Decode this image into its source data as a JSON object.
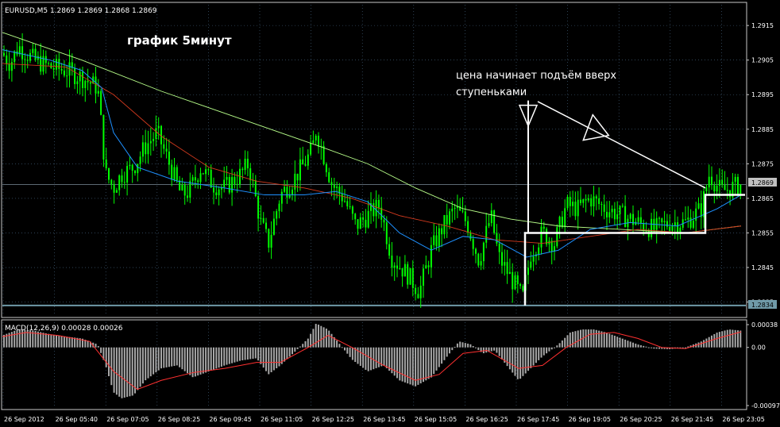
{
  "chart_data": [
    {
      "type": "candlestick",
      "title": "EURUSD,M5  1.2869 1.2869 1.2868 1.2869",
      "annotation_title": "график 5минут",
      "annotation_note": [
        "цена начинает подъём вверх",
        "ступеньками"
      ],
      "y_ticks": [
        "1.2915",
        "1.2905",
        "1.2895",
        "1.2885",
        "1.2875",
        "1.2865",
        "1.2855",
        "1.2845",
        "1.2835"
      ],
      "y_range": [
        1.2831,
        1.2921
      ],
      "current_price": "1.2869",
      "line_price": "1.2834",
      "x_ticks": [
        "26 Sep 2012",
        "26 Sep 05:40",
        "26 Sep 07:05",
        "26 Sep 08:25",
        "26 Sep 09:45",
        "26 Sep 11:05",
        "26 Sep 12:25",
        "26 Sep 13:45",
        "26 Sep 15:05",
        "26 Sep 16:25",
        "26 Sep 17:45",
        "26 Sep 19:05",
        "26 Sep 20:25",
        "26 Sep 21:45",
        "26 Sep 23:05"
      ],
      "price_path": [
        [
          0,
          1.2907
        ],
        [
          10,
          1.2904
        ],
        [
          20,
          1.2909
        ],
        [
          40,
          1.2905
        ],
        [
          60,
          1.2903
        ],
        [
          80,
          1.2902
        ],
        [
          100,
          1.29
        ],
        [
          120,
          1.2897
        ],
        [
          125,
          1.2885
        ],
        [
          130,
          1.2872
        ],
        [
          140,
          1.2868
        ],
        [
          150,
          1.2872
        ],
        [
          165,
          1.2874
        ],
        [
          180,
          1.288
        ],
        [
          195,
          1.2884
        ],
        [
          210,
          1.2875
        ],
        [
          225,
          1.2866
        ],
        [
          235,
          1.2867
        ],
        [
          250,
          1.2874
        ],
        [
          265,
          1.2869
        ],
        [
          280,
          1.2868
        ],
        [
          300,
          1.2872
        ],
        [
          310,
          1.2875
        ],
        [
          325,
          1.2858
        ],
        [
          335,
          1.2852
        ],
        [
          350,
          1.2866
        ],
        [
          365,
          1.287
        ],
        [
          380,
          1.2875
        ],
        [
          390,
          1.2879
        ],
        [
          395,
          1.2885
        ],
        [
          405,
          1.2877
        ],
        [
          415,
          1.2869
        ],
        [
          430,
          1.2865
        ],
        [
          445,
          1.2857
        ],
        [
          460,
          1.286
        ],
        [
          475,
          1.2863
        ],
        [
          490,
          1.2848
        ],
        [
          510,
          1.2843
        ],
        [
          525,
          1.2838
        ],
        [
          540,
          1.285
        ],
        [
          555,
          1.2857
        ],
        [
          570,
          1.2862
        ],
        [
          585,
          1.2858
        ],
        [
          600,
          1.2847
        ],
        [
          615,
          1.286
        ],
        [
          625,
          1.2848
        ],
        [
          640,
          1.2842
        ],
        [
          655,
          1.2836
        ],
        [
          665,
          1.2849
        ],
        [
          680,
          1.2855
        ],
        [
          695,
          1.2852
        ],
        [
          710,
          1.2863
        ],
        [
          725,
          1.2862
        ],
        [
          740,
          1.2865
        ],
        [
          760,
          1.2862
        ],
        [
          780,
          1.286
        ],
        [
          800,
          1.2858
        ],
        [
          820,
          1.2856
        ],
        [
          840,
          1.2858
        ],
        [
          860,
          1.2858
        ],
        [
          880,
          1.2862
        ],
        [
          890,
          1.2872
        ],
        [
          905,
          1.2867
        ],
        [
          930,
          1.2869
        ]
      ],
      "ma_blue": [
        [
          0,
          1.2908
        ],
        [
          60,
          1.2905
        ],
        [
          100,
          1.2902
        ],
        [
          125,
          1.2897
        ],
        [
          140,
          1.2884
        ],
        [
          170,
          1.2874
        ],
        [
          220,
          1.287
        ],
        [
          280,
          1.2868
        ],
        [
          330,
          1.2866
        ],
        [
          380,
          1.2866
        ],
        [
          420,
          1.2867
        ],
        [
          460,
          1.2864
        ],
        [
          500,
          1.2855
        ],
        [
          540,
          1.285
        ],
        [
          580,
          1.2854
        ],
        [
          620,
          1.2853
        ],
        [
          660,
          1.2848
        ],
        [
          700,
          1.285
        ],
        [
          740,
          1.2856
        ],
        [
          790,
          1.2858
        ],
        [
          850,
          1.2857
        ],
        [
          900,
          1.2862
        ],
        [
          930,
          1.2866
        ]
      ],
      "ma_red": [
        [
          0,
          1.2904
        ],
        [
          80,
          1.2903
        ],
        [
          140,
          1.2895
        ],
        [
          200,
          1.2883
        ],
        [
          260,
          1.2874
        ],
        [
          320,
          1.287
        ],
        [
          380,
          1.2868
        ],
        [
          440,
          1.2865
        ],
        [
          500,
          1.286
        ],
        [
          560,
          1.2857
        ],
        [
          620,
          1.2853
        ],
        [
          680,
          1.2852
        ],
        [
          740,
          1.2854
        ],
        [
          800,
          1.2856
        ],
        [
          860,
          1.2855
        ],
        [
          930,
          1.2857
        ]
      ],
      "ma_green": [
        [
          0,
          1.2913
        ],
        [
          100,
          1.2905
        ],
        [
          200,
          1.2896
        ],
        [
          300,
          1.2888
        ],
        [
          400,
          1.288
        ],
        [
          460,
          1.2875
        ],
        [
          520,
          1.2868
        ],
        [
          580,
          1.2862
        ],
        [
          640,
          1.2859
        ],
        [
          700,
          1.2857
        ],
        [
          780,
          1.2856
        ],
        [
          860,
          1.2855
        ],
        [
          930,
          1.2857
        ]
      ],
      "steps": [
        [
          658,
          1.2834
        ],
        [
          658,
          1.2855
        ],
        [
          706,
          1.2855
        ],
        [
          706,
          1.2855
        ],
        [
          885,
          1.2855
        ],
        [
          885,
          1.2866
        ],
        [
          935,
          1.2866
        ]
      ],
      "down_arrow": {
        "x": 662,
        "top": 1.2891
      },
      "diag_arrow": {
        "from": [
          674,
          1.2893
        ],
        "to": [
          885,
          1.2868
        ]
      },
      "colors": {
        "candle": "#00ff00",
        "ma_blue": "#1e90ff",
        "ma_red": "#d43a1e",
        "ma_green": "#b8ff8a",
        "grid": "#4a6a88",
        "steps": "#ffffff",
        "price_box": "#c0c0c0",
        "line_box": "#6f9aa8"
      }
    },
    {
      "type": "bar",
      "title": "MACD(12,26,9) 0.00028 0.00026",
      "y_ticks": [
        "0.00038",
        "0.00",
        "-0.00097"
      ],
      "y_range": [
        -0.00101,
        0.00042
      ],
      "histogram_path": [
        [
          0,
          0.0002
        ],
        [
          20,
          0.0003
        ],
        [
          40,
          0.00028
        ],
        [
          60,
          0.00022
        ],
        [
          80,
          0.00018
        ],
        [
          100,
          0.00015
        ],
        [
          120,
          5e-05
        ],
        [
          130,
          -0.0003
        ],
        [
          140,
          -0.00075
        ],
        [
          150,
          -0.00085
        ],
        [
          165,
          -0.0008
        ],
        [
          180,
          -0.00055
        ],
        [
          200,
          -0.00035
        ],
        [
          220,
          -0.0003
        ],
        [
          240,
          -0.0005
        ],
        [
          260,
          -0.0004
        ],
        [
          280,
          -0.0003
        ],
        [
          300,
          -0.00022
        ],
        [
          320,
          -0.00018
        ],
        [
          335,
          -0.00045
        ],
        [
          350,
          -0.0003
        ],
        [
          370,
          -5e-05
        ],
        [
          385,
          0.00015
        ],
        [
          395,
          0.0004
        ],
        [
          410,
          0.0003
        ],
        [
          425,
          5e-05
        ],
        [
          440,
          -0.0002
        ],
        [
          460,
          -0.0004
        ],
        [
          480,
          -0.0003
        ],
        [
          500,
          -0.00055
        ],
        [
          520,
          -0.00065
        ],
        [
          540,
          -0.0005
        ],
        [
          560,
          -0.00015
        ],
        [
          575,
          0.0001
        ],
        [
          590,
          5e-05
        ],
        [
          605,
          -0.0001
        ],
        [
          620,
          -5e-05
        ],
        [
          635,
          -0.0003
        ],
        [
          650,
          -0.00055
        ],
        [
          665,
          -0.00035
        ],
        [
          680,
          -0.00015
        ],
        [
          700,
          5e-05
        ],
        [
          715,
          0.00025
        ],
        [
          730,
          0.0003
        ],
        [
          745,
          0.0003
        ],
        [
          760,
          0.00025
        ],
        [
          780,
          0.00015
        ],
        [
          800,
          5e-05
        ],
        [
          820,
          -2e-05
        ],
        [
          840,
          -3e-05
        ],
        [
          860,
          0.0
        ],
        [
          880,
          0.0001
        ],
        [
          900,
          0.00025
        ],
        [
          915,
          0.0003
        ],
        [
          930,
          0.00028
        ]
      ],
      "signal_path": [
        [
          0,
          0.00018
        ],
        [
          30,
          0.00025
        ],
        [
          70,
          0.0002
        ],
        [
          110,
          0.0001
        ],
        [
          140,
          -0.0004
        ],
        [
          170,
          -0.0007
        ],
        [
          200,
          -0.00055
        ],
        [
          240,
          -0.00042
        ],
        [
          280,
          -0.00035
        ],
        [
          320,
          -0.00025
        ],
        [
          350,
          -0.00025
        ],
        [
          385,
          0.0
        ],
        [
          410,
          0.0002
        ],
        [
          440,
          0.0
        ],
        [
          480,
          -0.0003
        ],
        [
          520,
          -0.00055
        ],
        [
          550,
          -0.00045
        ],
        [
          580,
          -0.0001
        ],
        [
          610,
          -5e-05
        ],
        [
          650,
          -0.00035
        ],
        [
          680,
          -0.0003
        ],
        [
          710,
          0.0
        ],
        [
          740,
          0.00022
        ],
        [
          770,
          0.00025
        ],
        [
          800,
          0.00015
        ],
        [
          830,
          0.0
        ],
        [
          860,
          -2e-05
        ],
        [
          900,
          0.00015
        ],
        [
          930,
          0.00026
        ]
      ],
      "colors": {
        "hist": "#a8a8a8",
        "signal": "#ff3030"
      }
    }
  ]
}
